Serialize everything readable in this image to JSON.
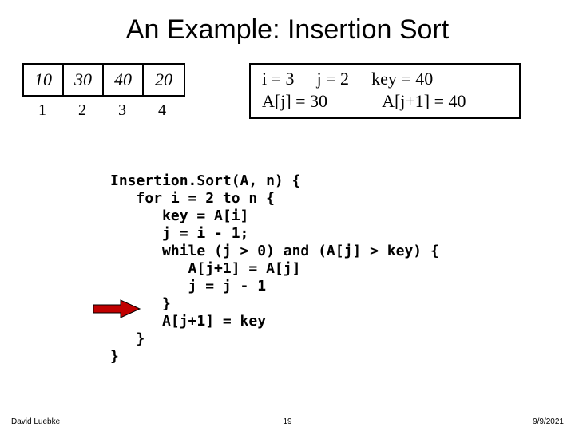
{
  "title": "An Example: Insertion Sort",
  "array": {
    "values": [
      "10",
      "30",
      "40",
      "20"
    ],
    "indices": [
      "1",
      "2",
      "3",
      "4"
    ]
  },
  "state": {
    "i_label": "i = 3",
    "j_label": "j = 2",
    "key_label": "key = 40",
    "aj_label": "A[j] = 30",
    "aj1_label": "A[j+1] = 40"
  },
  "code": "Insertion.Sort(A, n) {\n   for i = 2 to n {\n      key = A[i]\n      j = i - 1;\n      while (j > 0) and (A[j] > key) {\n         A[j+1] = A[j]\n         j = j - 1\n      }\n      A[j+1] = key\n   }\n}",
  "footer": {
    "author": "David Luebke",
    "page": "19",
    "date": "9/9/2021"
  }
}
